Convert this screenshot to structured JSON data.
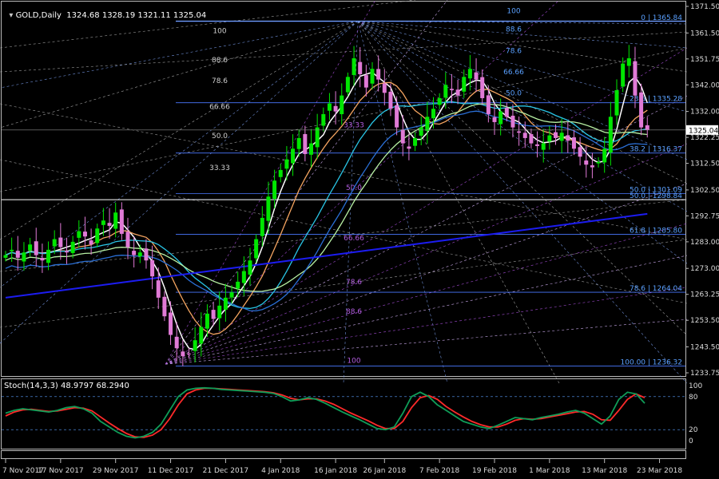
{
  "header": {
    "title": "GOLD,Daily",
    "ohlc": "1324.68 1328.19 1321.11 1325.04"
  },
  "stoch": {
    "label": "Stoch(14,3,3) 48.9797 68.2940",
    "levels": [
      100,
      80,
      20,
      0
    ],
    "k": [
      50,
      55,
      58,
      56,
      54,
      52,
      55,
      60,
      62,
      58,
      50,
      35,
      25,
      15,
      8,
      5,
      8,
      15,
      30,
      55,
      80,
      92,
      95,
      96,
      95,
      93,
      92,
      91,
      90,
      89,
      88,
      86,
      80,
      72,
      74,
      78,
      75,
      68,
      60,
      52,
      45,
      38,
      30,
      22,
      20,
      25,
      50,
      80,
      88,
      80,
      65,
      55,
      45,
      35,
      30,
      25,
      22,
      28,
      35,
      42,
      40,
      38,
      42,
      45,
      48,
      52,
      55,
      50,
      40,
      30,
      45,
      75,
      88,
      85,
      68
    ],
    "d": [
      45,
      52,
      56,
      57,
      55,
      53,
      54,
      57,
      60,
      59,
      54,
      43,
      32,
      22,
      13,
      7,
      6,
      10,
      20,
      40,
      65,
      85,
      92,
      95,
      95,
      94,
      93,
      92,
      91,
      90,
      89,
      87,
      83,
      77,
      74,
      76,
      76,
      72,
      66,
      58,
      50,
      43,
      36,
      28,
      22,
      22,
      35,
      60,
      78,
      82,
      75,
      62,
      52,
      43,
      35,
      29,
      25,
      25,
      30,
      37,
      40,
      39,
      40,
      43,
      46,
      49,
      52,
      53,
      48,
      38,
      37,
      55,
      75,
      85,
      78
    ]
  },
  "colors": {
    "background": "#000000",
    "bull": "#00e600",
    "bear": "#e07ad6",
    "ma_fast": "#ffffff",
    "ma_orange": "#f4a460",
    "ma_cyan": "#29c5e6",
    "ma_green": "#b8f1a4",
    "ma_blue": "#2a6fd6",
    "ma_long": "#1c1cf0",
    "stoch_k": "#0f9d58",
    "stoch_d": "#ff2a2a"
  },
  "chart_data": {
    "type": "candlestick",
    "symbol": "GOLD",
    "timeframe": "Daily",
    "ylim": [
      1233.75,
      1371.5
    ],
    "y_ticks": [
      "1371.50",
      "1361.50",
      "1351.75",
      "1342.00",
      "1332.00",
      "1322.25",
      "1312.50",
      "1302.50",
      "1292.75",
      "1283.00",
      "1273.00",
      "1263.25",
      "1253.50",
      "1243.50",
      "1233.75"
    ],
    "x_ticks": [
      "7 Nov 2017",
      "17 Nov 2017",
      "29 Nov 2017",
      "11 Dec 2017",
      "21 Dec 2017",
      "4 Jan 2018",
      "16 Jan 2018",
      "26 Jan 2018",
      "7 Feb 2018",
      "19 Feb 2018",
      "1 Mar 2018",
      "13 Mar 2018",
      "23 Mar 2018"
    ],
    "x_tick_index": [
      0,
      9,
      18,
      27,
      36,
      45,
      54,
      62,
      71,
      80,
      89,
      98,
      107
    ],
    "last_price": "1325.04",
    "closes": [
      1278,
      1280,
      1277,
      1279,
      1282,
      1278,
      1276,
      1280,
      1284,
      1281,
      1279,
      1283,
      1287,
      1285,
      1282,
      1288,
      1291,
      1289,
      1294,
      1286,
      1281,
      1278,
      1279,
      1276,
      1270,
      1262,
      1255,
      1248,
      1243,
      1240,
      1241,
      1246,
      1251,
      1256,
      1254,
      1259,
      1262,
      1264,
      1268,
      1272,
      1276,
      1284,
      1292,
      1300,
      1306,
      1310,
      1314,
      1318,
      1322,
      1316,
      1320,
      1326,
      1331,
      1335,
      1332,
      1338,
      1345,
      1352,
      1346,
      1341,
      1348,
      1344,
      1339,
      1333,
      1326,
      1320,
      1318,
      1322,
      1326,
      1330,
      1333,
      1337,
      1342,
      1340,
      1338,
      1345,
      1348,
      1344,
      1337,
      1331,
      1328,
      1332,
      1330,
      1326,
      1324,
      1322,
      1320,
      1319,
      1320,
      1323,
      1322,
      1324,
      1321,
      1318,
      1315,
      1312,
      1311,
      1313,
      1318,
      1330,
      1340,
      1350,
      1352,
      1338,
      1326,
      1325
    ],
    "fib_levels": [
      {
        "text": "0 | 1365.84",
        "price": 1365.84
      },
      {
        "text": "23.6 | 1335.28",
        "price": 1335.28
      },
      {
        "text": "38.2 | 1316.37",
        "price": 1316.37
      },
      {
        "text": "50.0 | 1301.09",
        "price": 1301.09
      },
      {
        "text": "50.0 | 1298.84",
        "price": 1298.84
      },
      {
        "text": "61.8 | 1285.80",
        "price": 1285.8
      },
      {
        "text": "78.6 | 1264.04",
        "price": 1264.04
      },
      {
        "text": "100.00 | 1236.32",
        "price": 1236.32
      }
    ],
    "fib_labels_white": [
      {
        "text": "100",
        "price": 1361.5
      },
      {
        "text": "88.6",
        "price": 1350.5
      },
      {
        "text": "78.6",
        "price": 1342.7
      },
      {
        "text": "66.66",
        "price": 1333.0
      },
      {
        "text": "50.0",
        "price": 1322.0
      },
      {
        "text": "33.33",
        "price": 1310.0
      }
    ],
    "fib_labels_blue": [
      {
        "text": "100",
        "price": 1369.0
      },
      {
        "text": "88.6",
        "price": 1362.0
      },
      {
        "text": "78.6",
        "price": 1354.0
      },
      {
        "text": "66.66",
        "price": 1346.0
      },
      {
        "text": "50.0",
        "price": 1338.0
      }
    ],
    "fib_labels_purple": [
      {
        "text": "33.33",
        "price": 1326.0
      },
      {
        "text": "50.0",
        "price": 1302.5
      },
      {
        "text": "66.66",
        "price": 1283.5
      },
      {
        "text": "78.6",
        "price": 1267.0
      },
      {
        "text": "88.6",
        "price": 1256.0
      },
      {
        "text": "100",
        "price": 1237.5
      }
    ]
  }
}
